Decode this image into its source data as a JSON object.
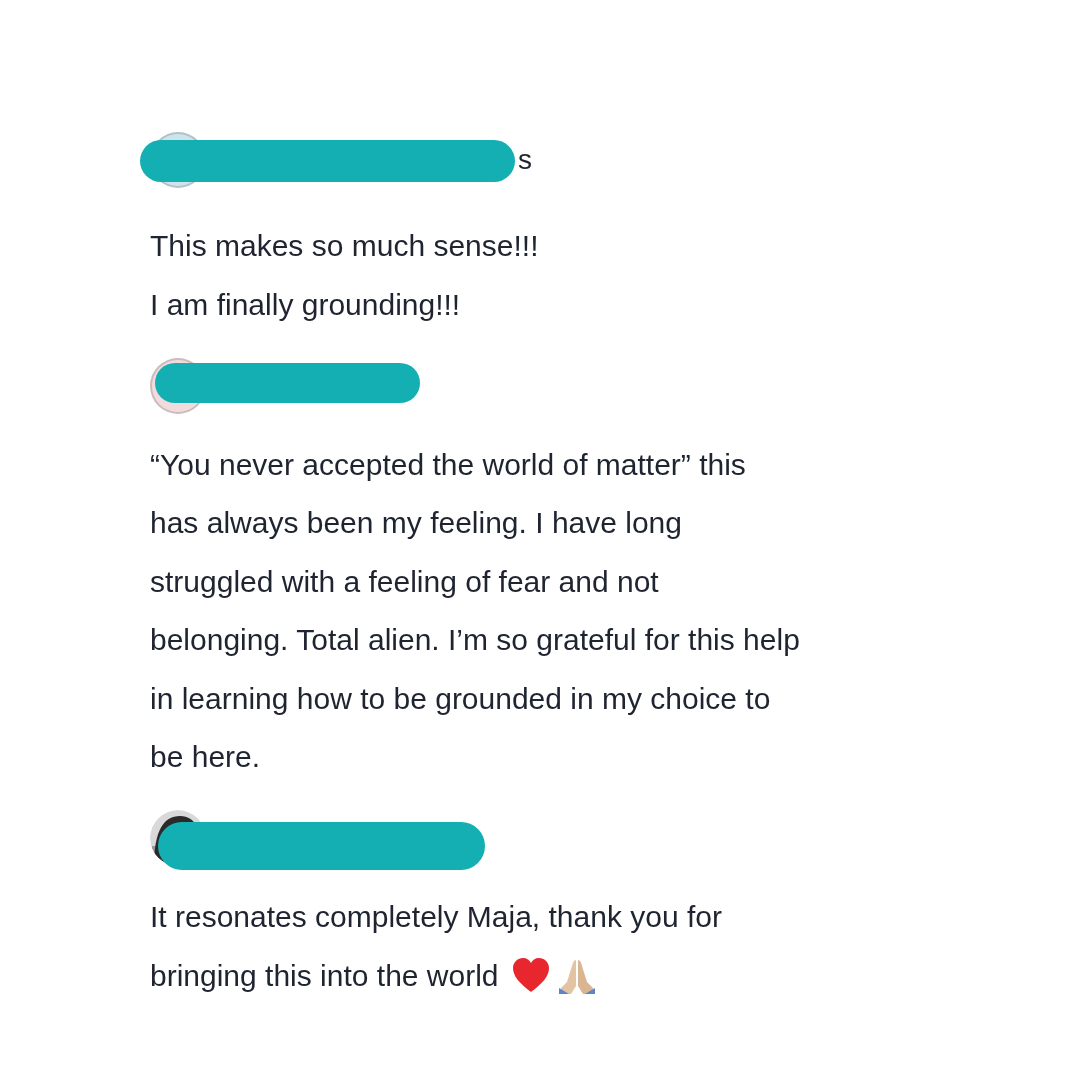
{
  "comments": [
    {
      "avatar": {
        "kind": "plain",
        "color": "#cfe3ec"
      },
      "author": "s",
      "lines": [
        "This makes so much sense!!!",
        "I am finally grounding!!!"
      ]
    },
    {
      "avatar": {
        "kind": "plain",
        "color": "#f1dcdd"
      },
      "lines": [
        "“You never accepted the world of matter” this",
        "has always been my feeling. I have long",
        "struggled with a feeling of fear and not",
        "belonging. Total alien. I’m so grateful for this help",
        "in learning how to be grounded in my choice to",
        "be here."
      ]
    },
    {
      "avatar": {
        "kind": "picture"
      },
      "lines": [
        "It resonates completely Maja, thank you for",
        "bringing this into the world"
      ]
    }
  ]
}
